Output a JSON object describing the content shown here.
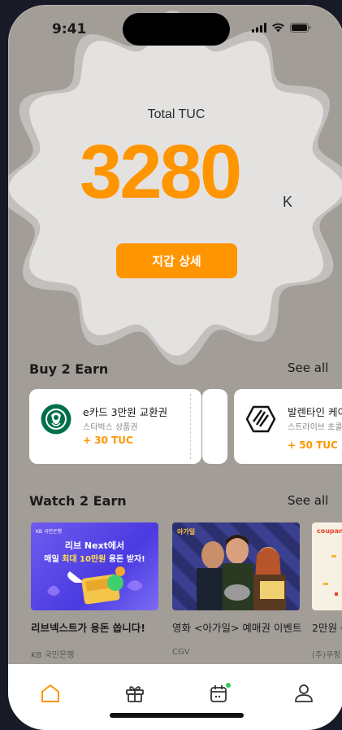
{
  "status_bar": {
    "time": "9:41"
  },
  "hero": {
    "label": "Total TUC",
    "amount": "3280",
    "unit": "K",
    "wallet_button": "지갑 상세"
  },
  "buy2earn": {
    "title": "Buy 2 Earn",
    "see_all": "See all",
    "items": [
      {
        "title": "e카드 3만원 교환권",
        "subtitle": "스타벅스 상품권",
        "reward": "+ 30 TUC",
        "logo": "starbucks-logo"
      },
      {
        "title": "발렌타인 케이",
        "subtitle": "스트라이브 초콜",
        "reward": "+ 50 TUC",
        "logo": "strive-logo"
      }
    ]
  },
  "watch2earn": {
    "title": "Watch 2 Earn",
    "see_all": "See all",
    "items": [
      {
        "title": "리브넥스트가 용돈 쏩니다!",
        "source": "KB 국민은행",
        "banner_brand": "KB 국민은행",
        "banner_line1": "리브 Next에서",
        "banner_line2a": "매일 ",
        "banner_line2b": "최대 10만원",
        "banner_line2c": " 용돈 받자!"
      },
      {
        "title": "영화 <아가일> 예매권 이벤트",
        "source": "CGV",
        "banner_brand": "아가일"
      },
      {
        "title": "2만원 쿠",
        "source": "(주)쿠팡",
        "banner_brand": "coupang"
      }
    ]
  },
  "tabbar": {
    "tabs": [
      {
        "name": "home",
        "active": true
      },
      {
        "name": "gift",
        "active": false
      },
      {
        "name": "calendar",
        "active": false,
        "badge": true
      },
      {
        "name": "profile",
        "active": false
      }
    ]
  },
  "colors": {
    "accent": "#ff9500",
    "background": "#a39d98",
    "badge": "#34c759"
  }
}
